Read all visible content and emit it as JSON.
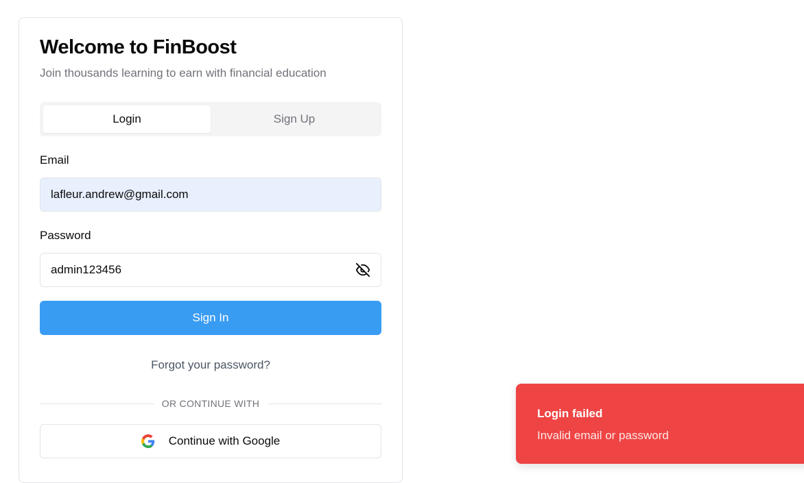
{
  "header": {
    "title": "Welcome to FinBoost",
    "subtitle": "Join thousands learning to earn with financial education"
  },
  "tabs": [
    {
      "label": "Login",
      "active": true
    },
    {
      "label": "Sign Up",
      "active": false
    }
  ],
  "form": {
    "email_label": "Email",
    "email_value": "lafleur.andrew@gmail.com",
    "password_label": "Password",
    "password_value": "admin123456",
    "password_visibility_icon": "eye-off-icon",
    "signin_label": "Sign In",
    "forgot_label": "Forgot your password?",
    "divider_label": "OR CONTINUE WITH",
    "google_label": "Continue with Google",
    "google_icon": "google-icon"
  },
  "toast": {
    "title": "Login failed",
    "description": "Invalid email or password"
  },
  "colors": {
    "primary": "#399cf3",
    "error": "#ef4444",
    "autofill": "#e8f0fe"
  }
}
